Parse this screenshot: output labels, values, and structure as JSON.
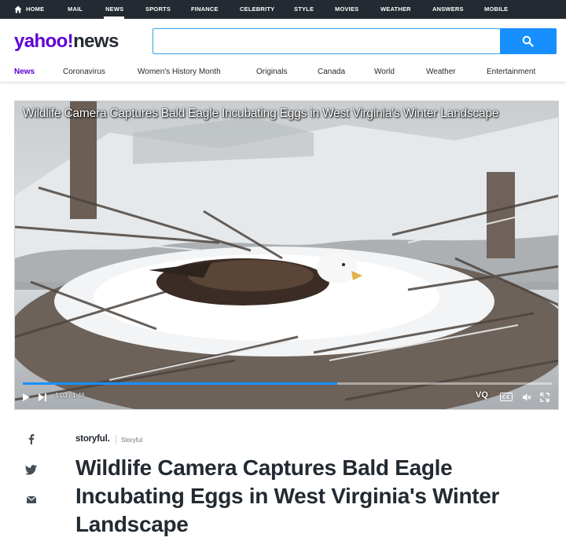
{
  "topnav": {
    "items": [
      "HOME",
      "MAIL",
      "NEWS",
      "SPORTS",
      "FINANCE",
      "CELEBRITY",
      "STYLE",
      "MOVIES",
      "WEATHER",
      "ANSWERS",
      "MOBILE"
    ],
    "active": "NEWS"
  },
  "logo": {
    "part1": "yahoo!",
    "part2": "news"
  },
  "search": {
    "value": "",
    "placeholder": ""
  },
  "secnav": {
    "items": [
      "News",
      "Coronavirus",
      "Women's History Month",
      "Originals",
      "Canada",
      "World",
      "Weather",
      "Entertainment"
    ],
    "active": "News"
  },
  "video": {
    "title": "Wildlife Camera Captures Bald Eagle Incubating Eggs in West Virginia's Winter Landscape",
    "time": "1:03 / 1:46",
    "progress": 0.595,
    "quality_label": "VQ"
  },
  "article": {
    "provider_logo": "storyful.",
    "provider_name": "Storyful",
    "headline": "Wildlife Camera Captures Bald Eagle Incubating Eggs in West Virginia's Winter Landscape"
  },
  "colors": {
    "brand": "#6001d2",
    "accent": "#188fff",
    "topbar": "#232a31"
  },
  "icons": [
    "home-icon",
    "search-icon",
    "play-icon",
    "next-icon",
    "captions-icon",
    "mute-icon",
    "fullscreen-icon",
    "facebook-icon",
    "twitter-icon",
    "email-icon"
  ]
}
